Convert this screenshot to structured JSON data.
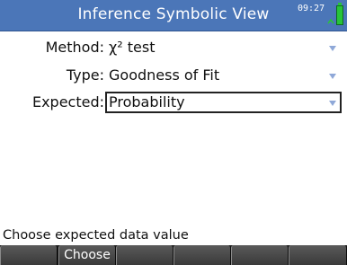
{
  "header": {
    "title": "Inference Symbolic View",
    "time": "09:27",
    "battery_icon": "battery-icon",
    "charging_icon": "plug-icon",
    "accent_color": "#4b76b8"
  },
  "form": {
    "method": {
      "label": "Method:",
      "value": "χ² test"
    },
    "type": {
      "label": "Type:",
      "value": "Goodness of Fit"
    },
    "expected": {
      "label": "Expected:",
      "value": "Probability"
    }
  },
  "status": {
    "text": "Choose expected data value"
  },
  "menu": {
    "items": [
      "",
      "Choose",
      "",
      "",
      "",
      ""
    ]
  }
}
